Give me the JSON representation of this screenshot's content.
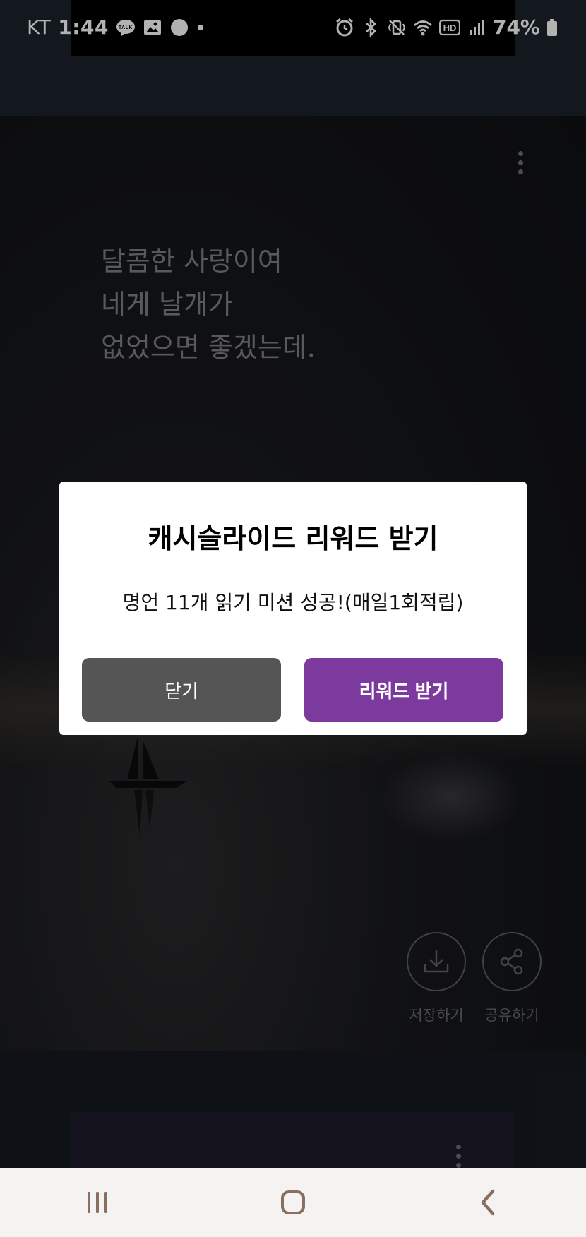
{
  "status_bar": {
    "carrier": "KT",
    "time": "1:44",
    "battery": "74%",
    "left_icons": [
      "kakaotalk-icon",
      "gallery-icon",
      "settings-icon",
      "dot-icon"
    ],
    "right_icons": [
      "alarm-icon",
      "bluetooth-icon",
      "vibrate-icon",
      "wifi-icon",
      "hd-icon",
      "signal-icon",
      "battery-icon"
    ],
    "talk_badge": "TALK",
    "hd_badge": "HD"
  },
  "card": {
    "quote_lines": [
      "달콤한 사랑이여",
      "네게 날개가",
      "없었으면 좋겠는데."
    ],
    "actions": {
      "save_label": "저장하기",
      "share_label": "공유하기"
    }
  },
  "dialog": {
    "title": "캐시슬라이드 리워드 받기",
    "message": "명언 11개 읽기 미션 성공!(매일1회적립)",
    "close_label": "닫기",
    "reward_label": "리워드 받기",
    "colors": {
      "close": "#555555",
      "reward": "#7d3a9e"
    }
  },
  "nav": {
    "items": [
      "recent-apps-icon",
      "home-icon",
      "back-icon"
    ]
  }
}
